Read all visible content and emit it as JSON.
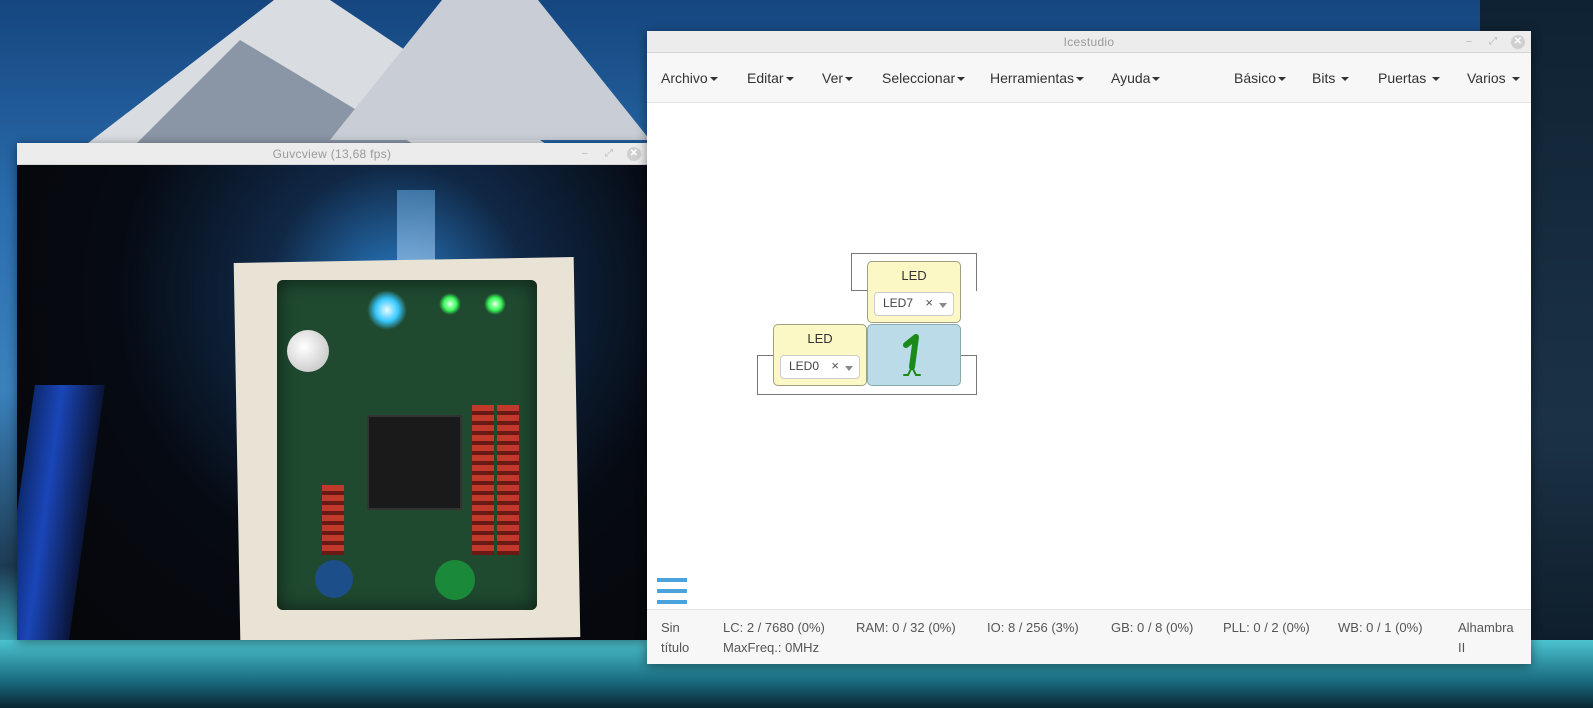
{
  "desktop": {},
  "guvcview": {
    "title": "Guvcview  (13,68 fps)",
    "controls": {
      "minimize": "–",
      "maximize": "⤢",
      "close": "✕"
    }
  },
  "icestudio": {
    "title": "Icestudio",
    "controls": {
      "minimize": "–",
      "maximize": "⤢",
      "close": "✕"
    },
    "menu_left": [
      "Archivo",
      "Editar",
      "Ver",
      "Seleccionar",
      "Herramientas",
      "Ayuda"
    ],
    "menu_right": [
      "Básico",
      "Bits",
      "Puertas",
      "Varios"
    ],
    "blocks": {
      "led_top": {
        "title": "LED",
        "value": "LED7",
        "clear": "×"
      },
      "led_bottom": {
        "title": "LED",
        "value": "LED0",
        "clear": "×"
      },
      "constant": {
        "value": "1"
      }
    },
    "status": {
      "file_line1": "Sin",
      "file_line2": "título",
      "lc": "LC:  2 / 7680 (0%)",
      "maxfreq": "MaxFreq.:  0MHz",
      "ram": "RAM:  0 / 32 (0%)",
      "io": "IO:  8 / 256 (3%)",
      "gb": "GB:  0 / 8 (0%)",
      "pll": "PLL:  0 / 2 (0%)",
      "wb": "WB:  0 / 1 (0%)",
      "board_line1": "Alhambra",
      "board_line2": "II"
    }
  }
}
